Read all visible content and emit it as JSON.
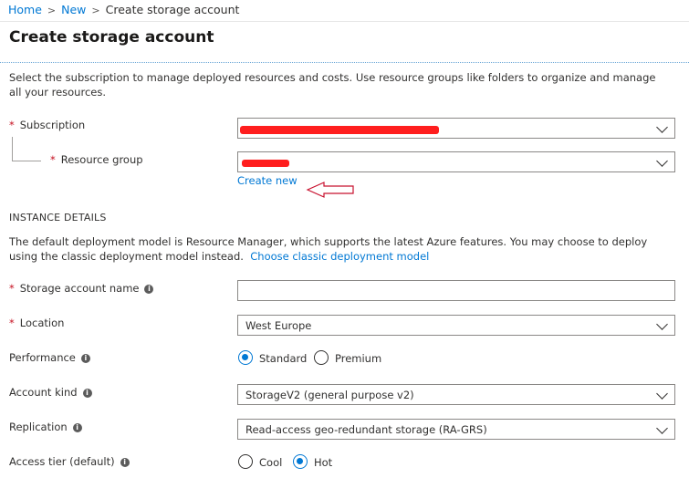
{
  "breadcrumb": {
    "home": "Home",
    "new": "New",
    "current": "Create storage account",
    "separator": ">"
  },
  "page_title": "Create storage account",
  "description": "Select the subscription to manage deployed resources and costs. Use resource groups like folders to organize and manage all your resources.",
  "fields": {
    "subscription": {
      "label": "Subscription",
      "required_mark": "*"
    },
    "resource_group": {
      "label": "Resource group",
      "required_mark": "*",
      "create_new": "Create new"
    },
    "instance_details": {
      "heading": "INSTANCE DETAILS",
      "text": "The default deployment model is Resource Manager, which supports the latest Azure features. You may choose to deploy using the classic deployment model instead.",
      "link": "Choose classic deployment model"
    },
    "storage_account_name": {
      "label": "Storage account name",
      "required_mark": "*",
      "value": ""
    },
    "location": {
      "label": "Location",
      "required_mark": "*",
      "value": "West Europe"
    },
    "performance": {
      "label": "Performance",
      "options": [
        "Standard",
        "Premium"
      ],
      "selected": "Standard"
    },
    "account_kind": {
      "label": "Account kind",
      "value": "StorageV2 (general purpose v2)"
    },
    "replication": {
      "label": "Replication",
      "value": "Read-access geo-redundant storage (RA-GRS)"
    },
    "access_tier": {
      "label": "Access tier (default)",
      "options": [
        "Cool",
        "Hot"
      ],
      "selected": "Hot"
    }
  },
  "icons": {
    "info": "info-icon",
    "info_glyph": "i",
    "dropdown": "chevron-down-icon"
  },
  "colors": {
    "link": "#0078d4",
    "required": "#c50f1f",
    "redaction": "#ff1e1e",
    "annotation_arrow": "#c8102e"
  }
}
